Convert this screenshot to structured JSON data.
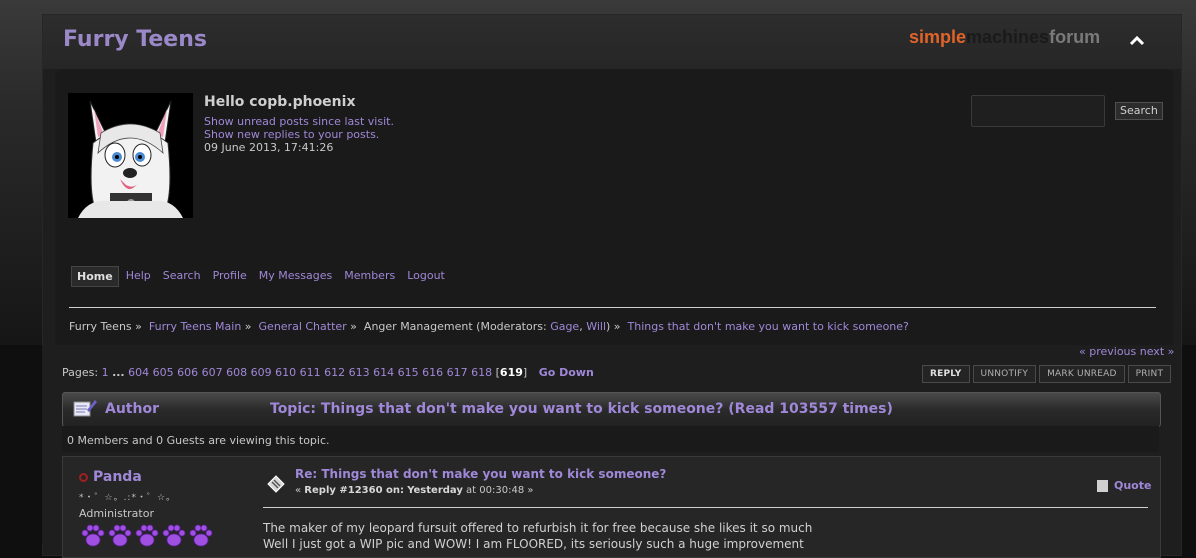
{
  "header": {
    "forum_title": "Furry Teens",
    "logo_part1": "simple",
    "logo_part2": "machines",
    "logo_part3": "forum"
  },
  "user": {
    "greeting": "Hello copb.phoenix",
    "unread_link": "Show unread posts since last visit.",
    "replies_link": "Show new replies to your posts.",
    "datetime": "09 June 2013, 17:41:26"
  },
  "search": {
    "button_label": "Search",
    "placeholder": ""
  },
  "menu": [
    {
      "label": "Home"
    },
    {
      "label": "Help"
    },
    {
      "label": "Search"
    },
    {
      "label": "Profile"
    },
    {
      "label": "My Messages"
    },
    {
      "label": "Members"
    },
    {
      "label": "Logout"
    }
  ],
  "breadcrumb": {
    "crumb1": "Furry Teens",
    "crumb2": "Furry Teens Main",
    "crumb3": "General Chatter",
    "board": "Anger Management",
    "mods_prefix": "(Moderators:",
    "mod1": "Gage",
    "mod2": "Will",
    "mods_suffix": ")",
    "topic": "Things that don't make you want to kick someone?"
  },
  "nav": {
    "previous": "« previous",
    "next": "next »"
  },
  "pages": {
    "label": "Pages:",
    "first": "1",
    "ellipsis": "...",
    "list": [
      "604",
      "605",
      "606",
      "607",
      "608",
      "609",
      "610",
      "611",
      "612",
      "613",
      "614",
      "615",
      "616",
      "617",
      "618"
    ],
    "current": "619",
    "go_down": "Go Down"
  },
  "buttons": {
    "reply": "REPLY",
    "unnotify": "UNNOTIFY",
    "mark_unread": "MARK UNREAD",
    "print": "PRINT"
  },
  "category": {
    "author": "Author",
    "topic_title": "Topic: Things that don't make you want to kick someone?  (Read 103557 times)"
  },
  "viewing": "0 Members and 0 Guests are viewing this topic.",
  "post": {
    "poster": "Panda",
    "stars": "*・゜☆。.:*・゜☆。",
    "rank": "Administrator",
    "subject": "Re: Things that don't make you want to kick someone?",
    "meta_prefix": "« ",
    "reply_no": "Reply #12360 on:",
    "when": "Yesterday",
    "time": " at 00:30:48 »",
    "quote": "Quote",
    "body_line1": "The maker of my leopard fursuit offered to refurbish it for free because she likes it so much",
    "body_line2": "Well I just got a WIP pic and WOW! I am FLOORED, its seriously such a huge improvement"
  },
  "colors": {
    "accent": "#a088d8",
    "logo_orange": "#e0642a",
    "background": "#1e1e1e"
  }
}
